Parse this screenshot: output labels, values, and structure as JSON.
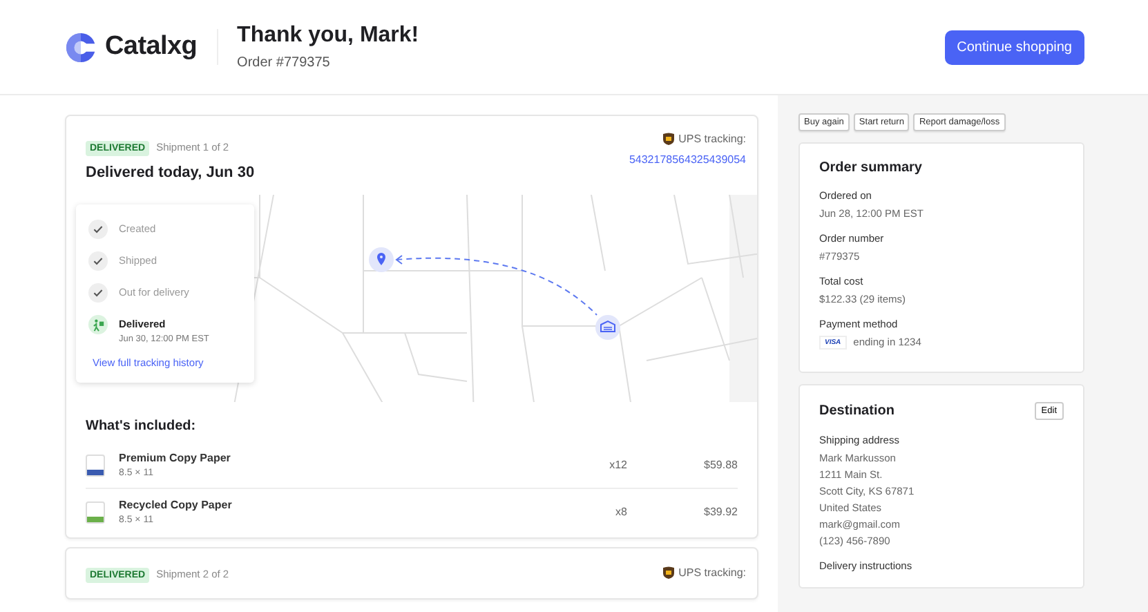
{
  "header": {
    "brand": "Catalxg",
    "title": "Thank you, Mark!",
    "order": "Order #779375",
    "action": "Continue shopping"
  },
  "shipments": [
    {
      "status": "DELIVERED",
      "shipment": "Shipment 1 of 2",
      "carrier": "UPS tracking:",
      "tracking": "5432178564325439054",
      "headline": "Delivered today, Jun 30",
      "steps": [
        {
          "kind": "check",
          "label": "Created"
        },
        {
          "kind": "check",
          "label": "Shipped"
        },
        {
          "kind": "check",
          "label": "Out for delivery"
        },
        {
          "kind": "delivered",
          "label": "Delivered",
          "time": "Jun 30, 12:00 PM EST"
        }
      ],
      "history_link": "View full tracking history",
      "included_title": "What's included:",
      "items": [
        {
          "name": "Premium Copy Paper",
          "size": "8.5 × 11",
          "qty": "x12",
          "price": "$59.88",
          "color": "#3a5bb0"
        },
        {
          "name": "Recycled Copy Paper",
          "size": "8.5 × 11",
          "qty": "x8",
          "price": "$39.92",
          "color": "#6bb04a"
        }
      ]
    },
    {
      "status": "DELIVERED",
      "shipment": "Shipment 2 of 2",
      "carrier": "UPS tracking:"
    }
  ],
  "actions": [
    "Buy again",
    "Start return",
    "Report damage/loss"
  ],
  "summary": {
    "title": "Order summary",
    "fields": [
      {
        "label": "Ordered on",
        "value": "Jun 28, 12:00 PM EST"
      },
      {
        "label": "Order number",
        "value": "#779375"
      },
      {
        "label": "Total cost",
        "value": "$122.33 (29 items)"
      },
      {
        "label": "Payment method",
        "kind": "card",
        "card": "VISA",
        "value": "ending in 1234"
      }
    ]
  },
  "destination": {
    "title": "Destination",
    "edit": "Edit",
    "address_label": "Shipping address",
    "lines": [
      "Mark Markusson",
      "1211 Main St.",
      "Scott City, KS 67871",
      "United States"
    ],
    "contact": [
      "mark@gmail.com",
      "(123) 456-7890"
    ],
    "instructions_label": "Delivery instructions"
  }
}
